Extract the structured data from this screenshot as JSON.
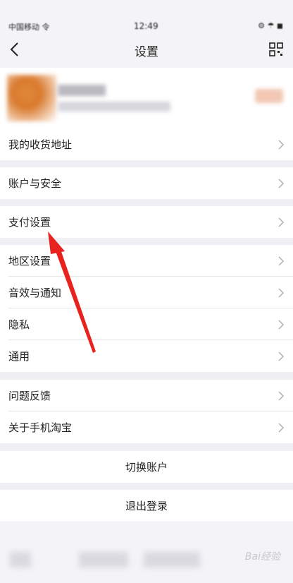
{
  "statusbar": {
    "carrier": "中国移动 令",
    "time": "12:49",
    "icons": "⚙ ☂ ◼"
  },
  "navbar": {
    "title": "设置",
    "back_icon": "chevron-left-icon",
    "qr_icon": "qr-code-icon"
  },
  "menu": {
    "address": "我的收货地址",
    "account_security": "账户与安全",
    "payment": "支付设置",
    "region": "地区设置",
    "sound_notify": "音效与通知",
    "privacy": "隐私",
    "general": "通用",
    "feedback": "问题反馈",
    "about": "关于手机淘宝"
  },
  "actions": {
    "switch_account": "切换账户",
    "logout": "退出登录"
  },
  "watermark": "Bai经验"
}
